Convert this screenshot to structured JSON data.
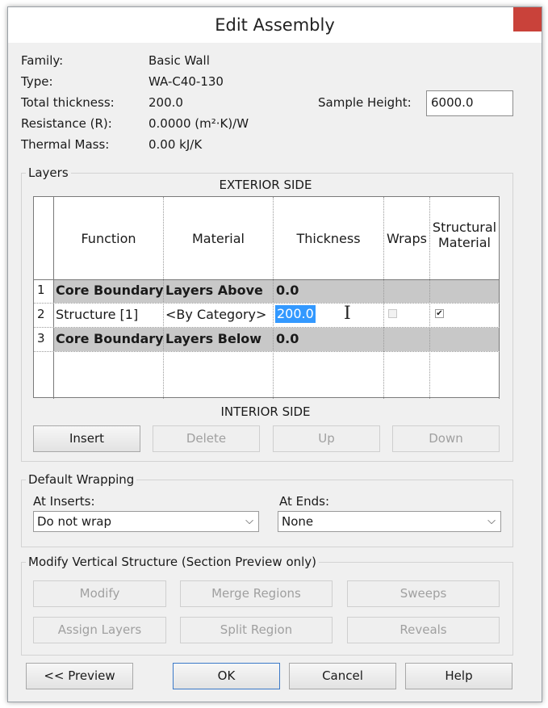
{
  "dialog": {
    "title": "Edit Assembly",
    "close_glyph": "✕"
  },
  "properties": {
    "family_label": "Family:",
    "family_value": "Basic Wall",
    "type_label": "Type:",
    "type_value": "WA-C40-130",
    "thickness_label": "Total thickness:",
    "thickness_value": "200.0",
    "resistance_label": "Resistance (R):",
    "resistance_value": "0.0000 (m²·K)/W",
    "thermal_label": "Thermal Mass:",
    "thermal_value": "0.00 kJ/K",
    "sample_height_label": "Sample Height:",
    "sample_height_value": "6000.0"
  },
  "layers": {
    "group_label": "Layers",
    "exterior_label": "EXTERIOR SIDE",
    "interior_label": "INTERIOR SIDE",
    "columns": {
      "function": "Function",
      "material": "Material",
      "thickness": "Thickness",
      "wraps": "Wraps",
      "structural1": "Structural",
      "structural2": "Material"
    },
    "rows": [
      {
        "num": "1",
        "function": "Core Boundary",
        "material": "Layers Above",
        "thickness": "0.0",
        "wraps": false,
        "structural": false
      },
      {
        "num": "2",
        "function": "Structure [1]",
        "material": "<By Category>",
        "thickness": "200.0",
        "wraps": false,
        "structural": true
      },
      {
        "num": "3",
        "function": "Core Boundary",
        "material": "Layers Below",
        "thickness": "0.0",
        "wraps": false,
        "structural": false
      }
    ],
    "buttons": {
      "insert": "Insert",
      "delete": "Delete",
      "up": "Up",
      "down": "Down"
    }
  },
  "wrapping": {
    "group_label": "Default Wrapping",
    "inserts_label": "At Inserts:",
    "inserts_value": "Do not wrap",
    "ends_label": "At  Ends:",
    "ends_value": "None"
  },
  "vertical": {
    "group_label": "Modify Vertical Structure (Section Preview only)",
    "modify": "Modify",
    "merge": "Merge Regions",
    "sweeps": "Sweeps",
    "assign": "Assign Layers",
    "split": "Split Region",
    "reveals": "Reveals"
  },
  "footer": {
    "preview": "<< Preview",
    "ok": "OK",
    "cancel": "Cancel",
    "help": "Help"
  },
  "icons": {
    "checkmark": "✔",
    "dropdown": "⌵",
    "cursor": "I"
  },
  "colors": {
    "close_bg": "#c9423a",
    "selection": "#3399ff",
    "core_row": "#c8c8c8"
  }
}
